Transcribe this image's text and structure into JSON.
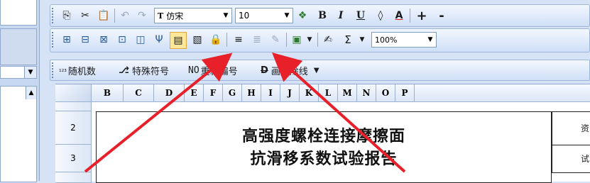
{
  "toolbar1": {
    "font_name": "仿宋",
    "font_size": "10",
    "bold": "B",
    "italic": "I",
    "underline": "U",
    "font_color": "A",
    "plus": "+"
  },
  "toolbar2": {
    "sum": "Σ",
    "zoom": "100%"
  },
  "toolbar3": {
    "random": "随机数",
    "special": "特殊符号",
    "renumber": "重新编号",
    "strike": "画删除线",
    "sub_label": "₁₂₃",
    "no_label": "NO"
  },
  "columns": [
    "B",
    "C",
    "D",
    "E",
    "F",
    "G",
    "H",
    "I",
    "J",
    "K",
    "L",
    "M",
    "N",
    "O",
    "P"
  ],
  "rows": [
    "2",
    "3"
  ],
  "title_line1": "高强度螺栓连接摩擦面",
  "title_line2": "抗滑移系数试验报告",
  "right_cells": [
    "资",
    "试"
  ],
  "colors": {
    "arrow": "#e8202a",
    "accent": "#ffe79a"
  }
}
